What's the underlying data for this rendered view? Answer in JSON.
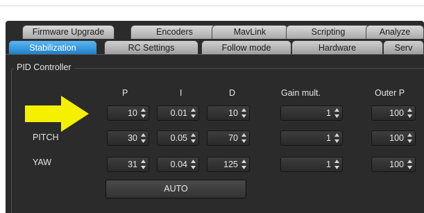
{
  "tabs_row1": [
    "Firmware Upgrade",
    "Encoders",
    "MavLink",
    "Scripting",
    "Analyze"
  ],
  "tabs_row2": [
    "Stabilization",
    "RC Settings",
    "Follow mode",
    "Hardware",
    "Serv"
  ],
  "active_tab": "Stabilization",
  "group_title": "PID Controller",
  "columns": [
    "P",
    "I",
    "D",
    "Gain mult.",
    "Outer P"
  ],
  "rows": [
    {
      "label": "",
      "P": "10",
      "I": "0.01",
      "D": "10",
      "gain": "1",
      "outer": "100"
    },
    {
      "label": "PITCH",
      "P": "30",
      "I": "0.05",
      "D": "70",
      "gain": "1",
      "outer": "100"
    },
    {
      "label": "YAW",
      "P": "31",
      "I": "0.04",
      "D": "125",
      "gain": "1",
      "outer": "100"
    }
  ],
  "auto_button": "AUTO",
  "colors": {
    "accent": "#2b8fe0",
    "annotation_arrow": "#f5f000",
    "panel": "#2b2b2b"
  },
  "icons": {
    "annotation": "yellow-arrow-right-icon",
    "spinner": "spinner-arrows-icon"
  }
}
